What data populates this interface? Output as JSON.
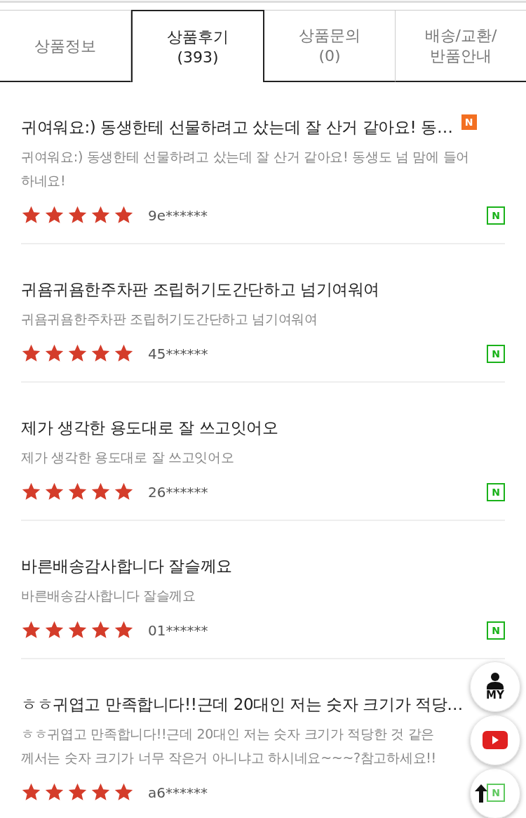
{
  "tabs": [
    {
      "label": "상품정보",
      "selected": false
    },
    {
      "label": "상품후기\n(393)",
      "selected": true
    },
    {
      "label": "상품문의\n(0)",
      "selected": false
    },
    {
      "label": "배송/교환/\n반품안내",
      "selected": false
    }
  ],
  "reviews": [
    {
      "title": "귀여워요:) 동생한테 선물하려고 샀는데 잘 산거 같아요! 동…",
      "new_badge": "N",
      "body_lines": [
        "귀여워요:) 동생한테 선물하려고 샀는데 잘 산거 같아요! 동생도 넘 맘에 들어",
        "하네요!"
      ],
      "stars": 5,
      "author": "9e******",
      "source_badge": "N"
    },
    {
      "title": "귀욤귀욤한주차판 조립허기도간단하고 넘기여워여",
      "body_lines": [
        "귀욤귀욤한주차판 조립허기도간단하고 넘기여워여"
      ],
      "stars": 5,
      "author": "45******",
      "source_badge": "N"
    },
    {
      "title": "제가 생각한 용도대로 잘 쓰고잇어오",
      "body_lines": [
        "제가 생각한 용도대로 잘 쓰고잇어오"
      ],
      "stars": 5,
      "author": "26******",
      "source_badge": "N"
    },
    {
      "title": "바른배송감사합니다 잘슬께요",
      "body_lines": [
        "바른배송감사합니다 잘슬께요"
      ],
      "stars": 5,
      "author": "01******",
      "source_badge": "N"
    },
    {
      "title": "ㅎㅎ귀엽고 만족합니다!!근데 20대인 저는 숫자 크기가 적당…",
      "body_lines": [
        "ㅎㅎ귀엽고 만족합니다!!근데 20대인 저는 숫자 크기가 적당한 것 같은",
        "께서는 숫자 크기가 너무 작은거 아니냐고 하시네요~~~?참고하세요!!"
      ],
      "stars": 5,
      "author": "a6******",
      "source_badge": "N"
    }
  ],
  "floating_buttons": [
    {
      "kind": "my",
      "label": "MY"
    },
    {
      "kind": "video"
    },
    {
      "kind": "top"
    }
  ]
}
